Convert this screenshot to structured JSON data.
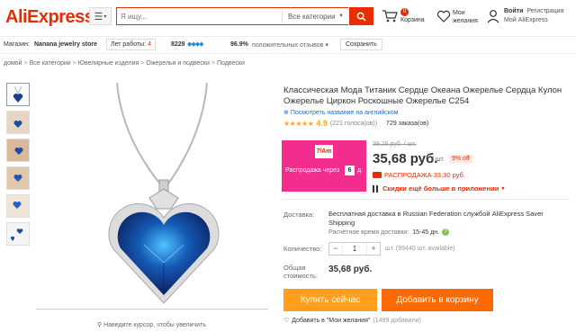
{
  "header": {
    "logo": "AliExpress",
    "search_placeholder": "Я ищу...",
    "category": "Все категории",
    "cart_count": "0",
    "cart_label": "Корзина",
    "wishlist_label": "Мои желания",
    "signin": "Войти",
    "register": "Регистрация",
    "my_account": "Мой AliExpress"
  },
  "store": {
    "label": "Магазин:",
    "name": "Nanana jewelry store",
    "years_label": "Лет работы:",
    "years_value": "4",
    "score": "8229",
    "diamonds": "💎💎💎💎",
    "positive_pct": "96.9%",
    "feedback_text": "положительных отзывов",
    "save_label": "Сохранить"
  },
  "breadcrumb": [
    "домой",
    "Все категории",
    "Ювелирные изделия",
    "Ожерелья и подвески",
    "Подвески"
  ],
  "product": {
    "title": "Классическая Мода Титаник Сердце Океана Ожерелье Сердца Кулон Ожерелье Циркон Роскошные Ожерелье C254",
    "translate_link": "Посмотреть название на английском",
    "stars": "★★★★★",
    "rating": "4.9",
    "votes": "(221 голоса(ов))",
    "orders": "729 заказа(ов)",
    "zoom_hint": "Наведите курсор, чтобы увеличить"
  },
  "promo": {
    "logo": "7/Am",
    "text": "Распродажа через",
    "days": "6",
    "days_suffix": "д."
  },
  "pricing": {
    "old_price": "39,25 руб.",
    "old_unit": "/ шт.",
    "price": "35,68 руб.",
    "unit": "/ шт.",
    "discount": "9% off",
    "sale_text": "РАСПРОДАЖА 33,30 руб.",
    "app_text": "Скидки ещё больше в приложении"
  },
  "shipping": {
    "label": "Доставка:",
    "text": "Бесплатная доставка в Russian Federation службой AliExpress Saver Shipping",
    "time_label": "Расчётное время доставки:",
    "time_value": "15-45 дн."
  },
  "quantity": {
    "label": "Количество:",
    "value": "1",
    "note": "шт. (99440 шт. available)"
  },
  "total": {
    "label": "Общая стоимость:",
    "value": "35,68 руб."
  },
  "actions": {
    "buy_now": "Купить сейчас",
    "add_to_cart": "Добавить в корзину",
    "wishlist": "Добавить в \"Мои желания\"",
    "wishlist_count": "(1489 добавили)"
  },
  "colors": {
    "brand": "#e62e04",
    "buy_now": "#ff9f1c",
    "add_to_cart": "#ff6a00",
    "promo_bg": "#f32d8e"
  }
}
